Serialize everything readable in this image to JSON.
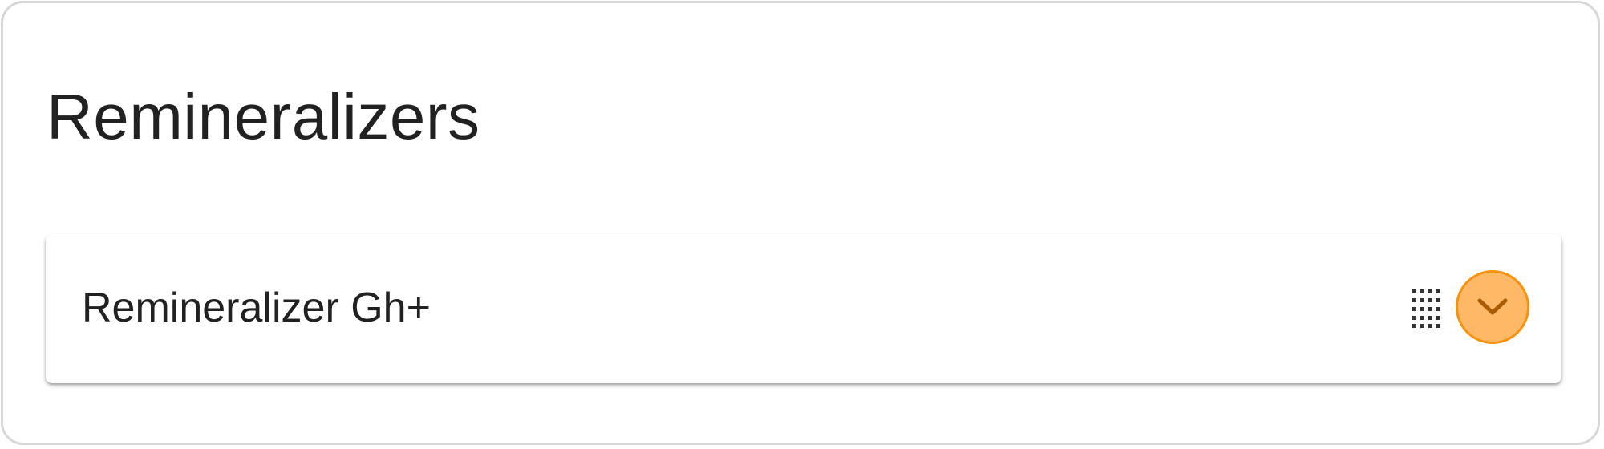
{
  "section": {
    "title": "Remineralizers"
  },
  "items": [
    {
      "name": "Remineralizer Gh+",
      "drag_handle_icon": "drag-handle-grid-icon",
      "expand_icon": "chevron-down-icon",
      "expanded": false
    }
  ],
  "colors": {
    "title_text": "#212121",
    "card_border": "#d7d7d7",
    "accent_fill": "#ffb866",
    "accent_stroke": "#f5920e",
    "chevron": "#a85b00",
    "handle": "#333333"
  }
}
